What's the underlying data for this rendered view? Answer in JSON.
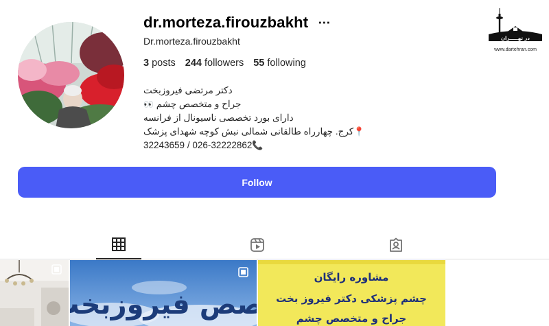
{
  "profile": {
    "username": "dr.morteza.firouzbakht",
    "more_icon": "⋯",
    "full_name": "Dr.morteza.firouzbakht",
    "stats": {
      "posts_count": "3",
      "posts_label": "posts",
      "followers_count": "244",
      "followers_label": "followers",
      "following_count": "55",
      "following_label": "following"
    },
    "bio": {
      "line1": "دکتر مرتضی فیروزبخت",
      "line2": "جراح و متخصص چشم",
      "line3": "دارای بورد تخصصی ناسیونال از فرانسه",
      "line4": "کرج. چهارراه طالقانی شمالی نبش کوچه شهدای پزشک",
      "line5": "32243659 / 026-32222862"
    },
    "follow_label": "Follow"
  },
  "tabs": [
    {
      "icon": "grid-icon",
      "active": true
    },
    {
      "icon": "reels-icon",
      "active": false
    },
    {
      "icon": "tagged-icon",
      "active": false
    }
  ],
  "grid": {
    "post2_text": "تخصص فیروزبخت",
    "post3_lines": [
      "مشاوره رایگان",
      "چشم پزشکی دکتر فیروز بخت",
      "جراح و متخصص چشم"
    ]
  },
  "watermark": {
    "logo_text": "در تهـــــران",
    "url": "www.dartehran.com"
  },
  "colors": {
    "follow_button": "#4a5cf7",
    "text": "#262626",
    "divider": "#dbdbdb"
  }
}
